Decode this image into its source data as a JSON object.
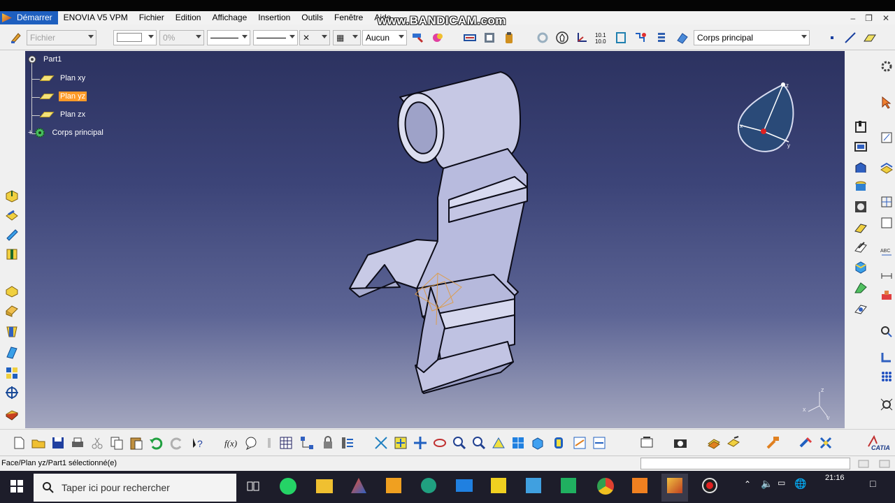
{
  "menubar": {
    "items": [
      "Démarrer",
      "ENOVIA V5 VPM",
      "Fichier",
      "Edition",
      "Affichage",
      "Insertion",
      "Outils",
      "Fenêtre",
      "Aide"
    ]
  },
  "watermark": "www.BANDICAM.com",
  "toolbar": {
    "fichier_placeholder": "Fichier",
    "percent": "0%",
    "aucun": "Aucun",
    "body_select": "Corps principal"
  },
  "tree": {
    "root": "Part1",
    "items": [
      {
        "label": "Plan xy",
        "selected": false
      },
      {
        "label": "Plan yz",
        "selected": true
      },
      {
        "label": "Plan zx",
        "selected": false
      },
      {
        "label": "Corps principal",
        "selected": false
      }
    ]
  },
  "compass": {
    "axes": [
      "x",
      "y",
      "z"
    ]
  },
  "axis_triad": {
    "labels": [
      "z",
      "x",
      "y"
    ]
  },
  "status": {
    "message": "Face/Plan yz/Part1 sélectionné(e)"
  },
  "taskbar": {
    "search_placeholder": "Taper ici pour rechercher",
    "time": "21:16"
  },
  "colors": {
    "selection": "#ff9a28",
    "viewport_top": "#2c3260",
    "viewport_bottom": "#a4a7bf",
    "part_face": "#c9cbe6",
    "menu_active": "#1e5fbf"
  }
}
